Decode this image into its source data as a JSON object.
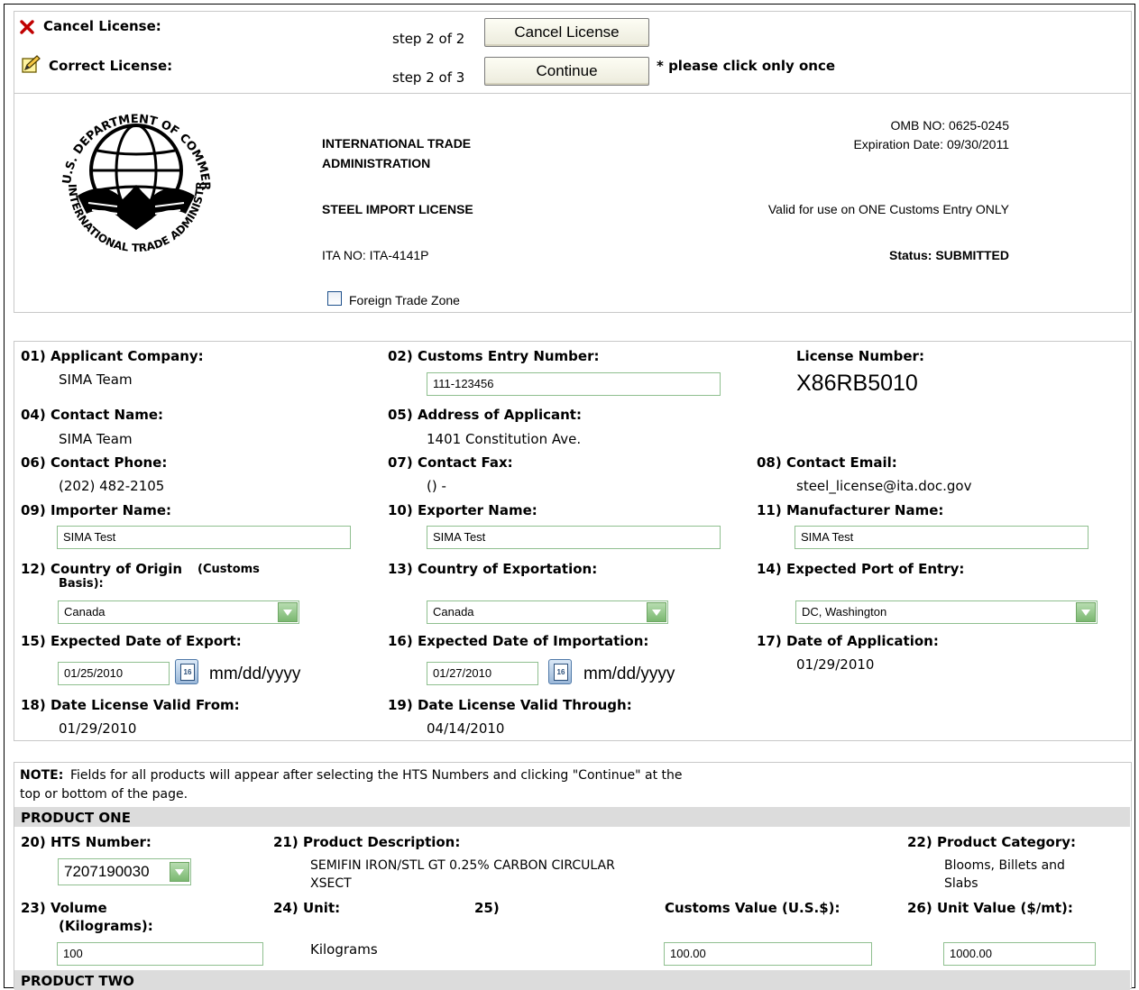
{
  "actions": {
    "cancel_label": "Cancel License:",
    "cancel_step": "step 2 of 2",
    "cancel_button": "Cancel License",
    "correct_label": "Correct License:",
    "correct_step": "step 2 of 3",
    "continue_button": "Continue",
    "note": "* please click only once"
  },
  "header": {
    "seal_top": "DEPARTMENT OF COMMERCE",
    "seal_left": "U.S.",
    "seal_bottom": "INTERNATIONAL TRADE ADMINISTRATION",
    "agency_line1": "INTERNATIONAL TRADE",
    "agency_line2": "ADMINISTRATION",
    "license_type": "STEEL IMPORT LICENSE",
    "ita_no": "ITA NO: ITA-4141P",
    "omb_no": "OMB NO: 0625-0245",
    "expiration": "Expiration Date: 09/30/2011",
    "valid_note": "Valid for use on ONE Customs Entry ONLY",
    "status": "Status: SUBMITTED",
    "ftz_label": "Foreign Trade Zone"
  },
  "form": {
    "f01_label": "01) Applicant Company:",
    "f01_value": "SIMA Team",
    "f02_label": "02) Customs Entry Number:",
    "f02_value": "111-123456",
    "license_label": "License Number:",
    "license_value": "X86RB5010",
    "f04_label": "04) Contact Name:",
    "f04_value": "SIMA Team",
    "f05_label": "05) Address of Applicant:",
    "f05_value": "1401 Constitution Ave.",
    "f06_label": "06) Contact Phone:",
    "f06_value": "(202) 482-2105",
    "f07_label": "07) Contact Fax:",
    "f07_value": "() -",
    "f08_label": "08) Contact Email:",
    "f08_value": "steel_license@ita.doc.gov",
    "f09_label": "09) Importer Name:",
    "f09_value": "SIMA Test",
    "f10_label": "10) Exporter Name:",
    "f10_value": "SIMA Test",
    "f11_label": "11) Manufacturer Name:",
    "f11_value": "SIMA Test",
    "f12_label": "12) Country of Origin",
    "f12_label_small": "(Customs",
    "f12_label_line2": "Basis):",
    "f12_value": "Canada",
    "f13_label": "13) Country of Exportation:",
    "f13_value": "Canada",
    "f14_label": "14) Expected Port of Entry:",
    "f14_value": "DC, Washington",
    "f15_label": "15) Expected Date of Export:",
    "f15_value": "01/25/2010",
    "f16_label": "16) Expected Date of Importation:",
    "f16_value": "01/27/2010",
    "date_format": "mm/dd/yyyy",
    "f17_label": "17) Date of Application:",
    "f17_value": "01/29/2010",
    "f18_label": "18) Date License Valid From:",
    "f18_value": "01/29/2010",
    "f19_label": "19) Date License Valid Through:",
    "f19_value": "04/14/2010"
  },
  "products": {
    "note_bold": "NOTE:",
    "note_line1": "Fields for all products will appear after selecting the HTS Numbers and clicking \"Continue\" at the",
    "note_line2": "top or bottom of the page.",
    "product_one": "PRODUCT ONE",
    "f20_label": "20) HTS Number:",
    "f20_value": "7207190030",
    "f21_label": "21) Product Description:",
    "f21_line1": "SEMIFIN IRON/STL GT 0.25% CARBON CIRCULAR",
    "f21_line2": "XSECT",
    "f22_label": "22) Product Category:",
    "f22_line1": "Blooms, Billets and",
    "f22_line2": "Slabs",
    "f23_label": "23) Volume",
    "f23_label_line2": "(Kilograms):",
    "f23_value": "100",
    "f24_label": "24) Unit:",
    "f24_value": "Kilograms",
    "f25_label": "25)",
    "customs_label": "Customs Value (U.S.$):",
    "customs_value": "100.00",
    "f26_label": "26) Unit Value ($/mt):",
    "f26_value": "1000.00",
    "product_two": "PRODUCT TWO"
  }
}
